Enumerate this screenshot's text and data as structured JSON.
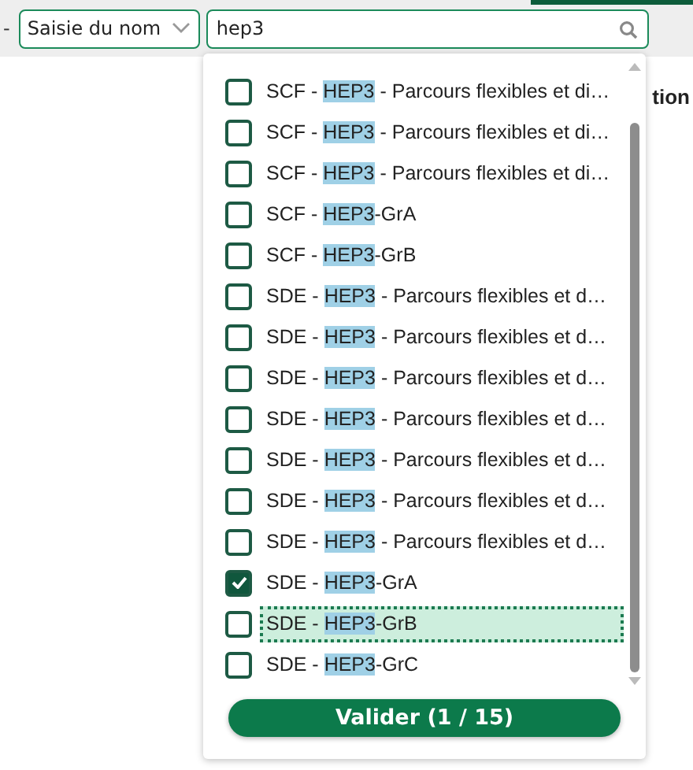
{
  "filter": {
    "separator": "-",
    "select": "Saisie du nom",
    "search_value": "hep3"
  },
  "background_heading": "tion",
  "options": [
    {
      "prefix": "SCF - ",
      "match": "HEP3",
      "suffix": " - Parcours flexibles et di…",
      "checked": false,
      "focused": false
    },
    {
      "prefix": "SCF - ",
      "match": "HEP3",
      "suffix": " - Parcours flexibles et di…",
      "checked": false,
      "focused": false
    },
    {
      "prefix": "SCF - ",
      "match": "HEP3",
      "suffix": " - Parcours flexibles et di…",
      "checked": false,
      "focused": false
    },
    {
      "prefix": "SCF - ",
      "match": "HEP3",
      "suffix": "-GrA",
      "checked": false,
      "focused": false
    },
    {
      "prefix": "SCF - ",
      "match": "HEP3",
      "suffix": "-GrB",
      "checked": false,
      "focused": false
    },
    {
      "prefix": "SDE - ",
      "match": "HEP3",
      "suffix": " - Parcours flexibles et d…",
      "checked": false,
      "focused": false
    },
    {
      "prefix": "SDE - ",
      "match": "HEP3",
      "suffix": " - Parcours flexibles et d…",
      "checked": false,
      "focused": false
    },
    {
      "prefix": "SDE - ",
      "match": "HEP3",
      "suffix": " - Parcours flexibles et d…",
      "checked": false,
      "focused": false
    },
    {
      "prefix": "SDE - ",
      "match": "HEP3",
      "suffix": " - Parcours flexibles et d…",
      "checked": false,
      "focused": false
    },
    {
      "prefix": "SDE - ",
      "match": "HEP3",
      "suffix": " - Parcours flexibles et d…",
      "checked": false,
      "focused": false
    },
    {
      "prefix": "SDE - ",
      "match": "HEP3",
      "suffix": " - Parcours flexibles et d…",
      "checked": false,
      "focused": false
    },
    {
      "prefix": "SDE - ",
      "match": "HEP3",
      "suffix": " - Parcours flexibles et d…",
      "checked": false,
      "focused": false
    },
    {
      "prefix": "SDE - ",
      "match": "HEP3",
      "suffix": "-GrA",
      "checked": true,
      "focused": false
    },
    {
      "prefix": "SDE - ",
      "match": "HEP3",
      "suffix": "-GrB",
      "checked": false,
      "focused": true
    },
    {
      "prefix": "SDE - ",
      "match": "HEP3",
      "suffix": "-GrC",
      "checked": false,
      "focused": false
    }
  ],
  "validate_button": "Valider (1 / 15)"
}
